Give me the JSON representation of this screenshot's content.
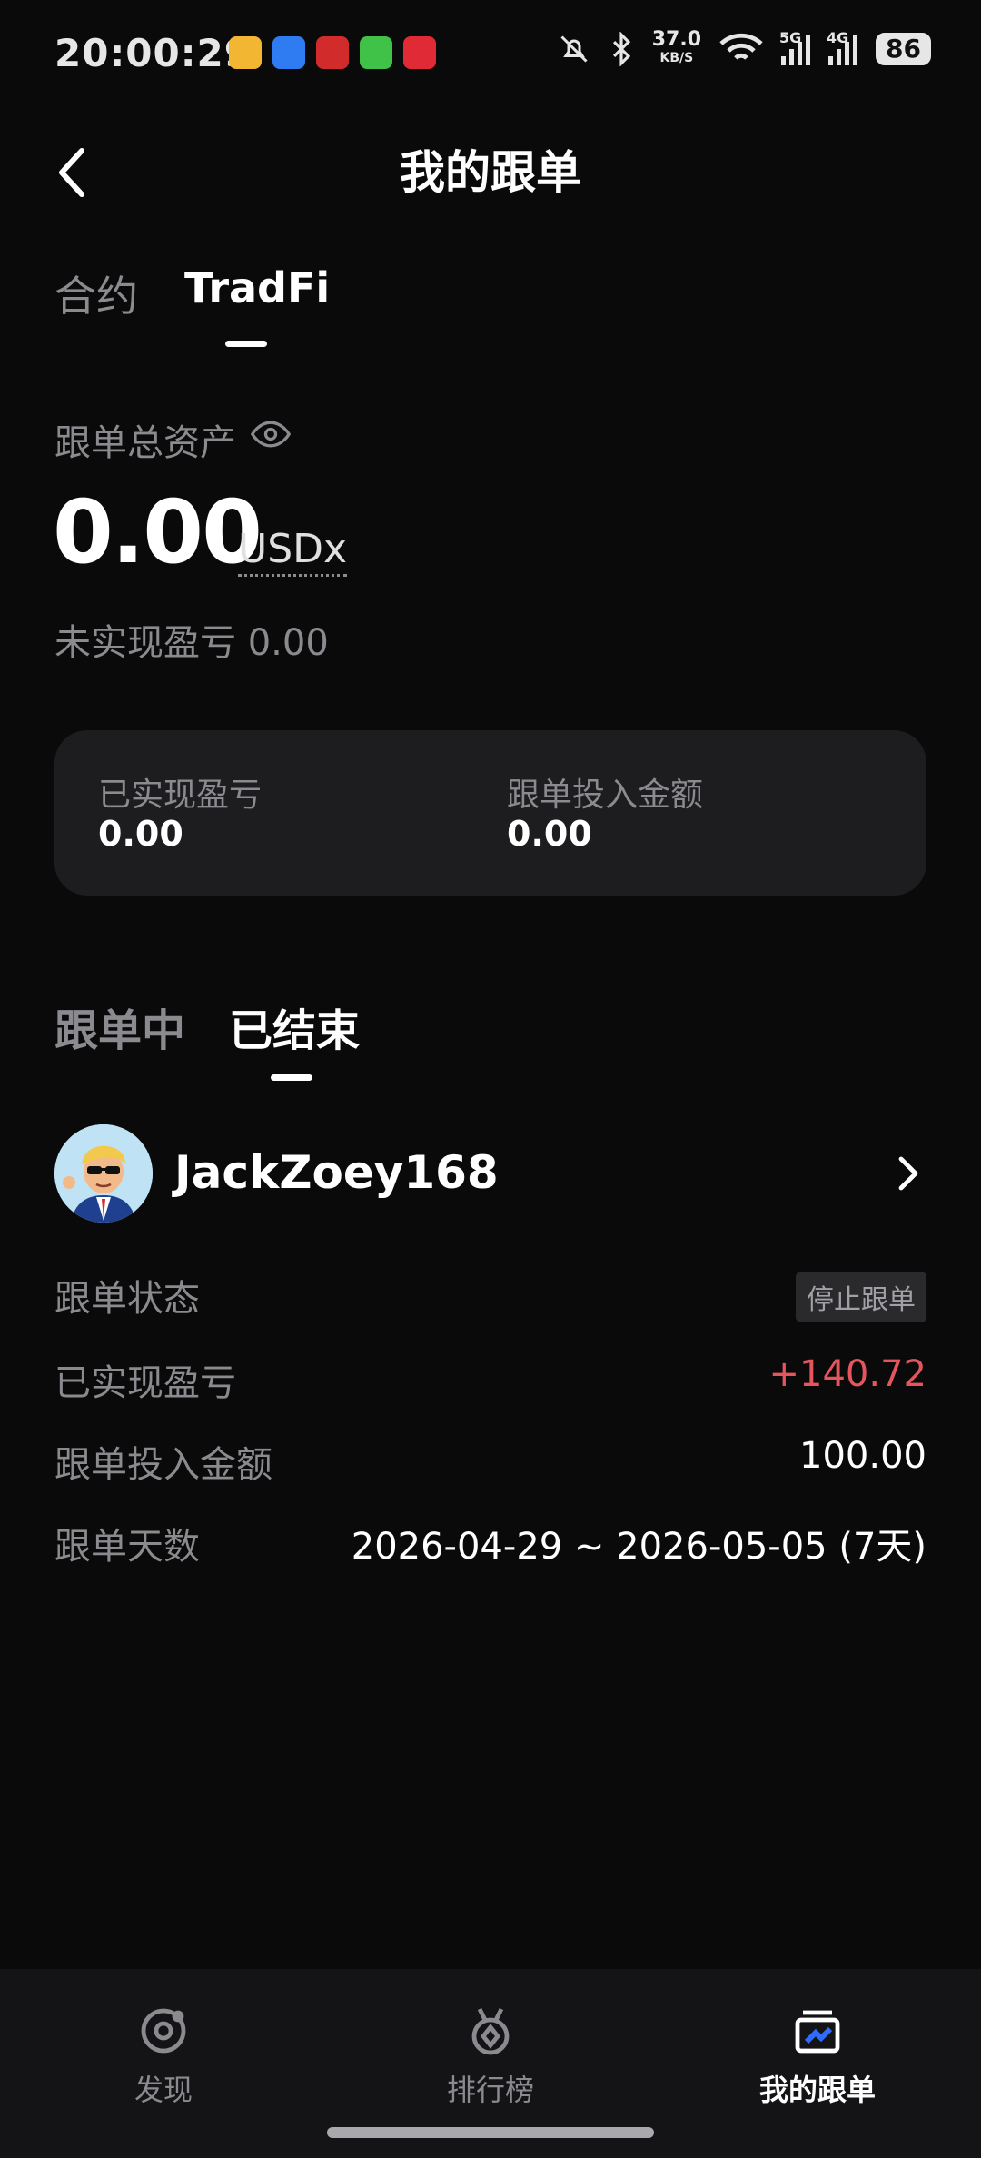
{
  "status_bar": {
    "time": "20:00:29",
    "net_speed": "37.0",
    "net_unit": "KB/S",
    "sig1_label": "5G",
    "sig2_label": "4G",
    "battery": "86"
  },
  "header": {
    "title": "我的跟单"
  },
  "top_tabs": [
    {
      "label": "合约"
    },
    {
      "label": "TradFi"
    }
  ],
  "summary": {
    "total_label": "跟单总资产",
    "total_value": "0.00",
    "unit": "USDx",
    "unrealized": "未实现盈亏 0.00"
  },
  "card": {
    "realized_label": "已实现盈亏",
    "realized_value": "0.00",
    "invest_label": "跟单投入金额",
    "invest_value": "0.00"
  },
  "sub_tabs": [
    {
      "label": "跟单中"
    },
    {
      "label": "已结束"
    }
  ],
  "trader": {
    "name": "JackZoey168",
    "rows": [
      {
        "label": "跟单状态",
        "value": "停止跟单"
      },
      {
        "label": "已实现盈亏",
        "value": "+140.72"
      },
      {
        "label": "跟单投入金额",
        "value": "100.00"
      },
      {
        "label": "跟单天数",
        "value": "2026-04-29 ~ 2026-05-05 (7天)"
      }
    ]
  },
  "nav": [
    {
      "label": "发现",
      "icon": "discover-icon"
    },
    {
      "label": "排行榜",
      "icon": "ranking-icon"
    },
    {
      "label": "我的跟单",
      "icon": "my-copy-icon"
    }
  ],
  "colors": {
    "background": "#0a0a0b",
    "card": "#1d1d20",
    "muted": "#8a8a8f",
    "profit": "#e5555e"
  }
}
